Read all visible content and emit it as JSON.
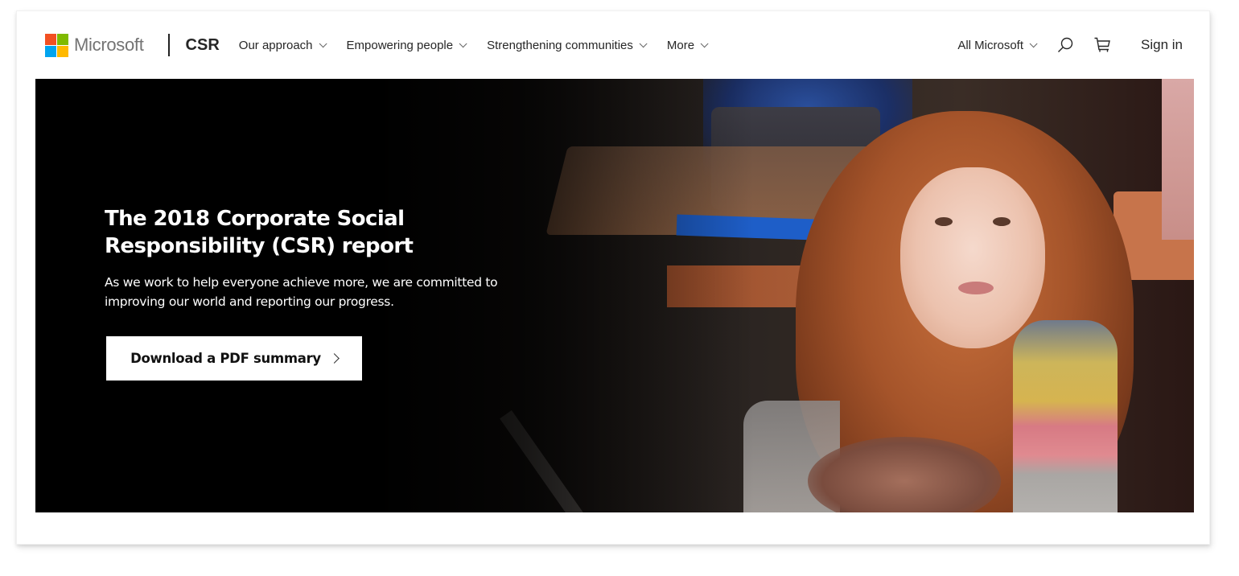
{
  "brand": {
    "company": "Microsoft",
    "section": "CSR",
    "logo_colors": [
      "#f25022",
      "#7fba00",
      "#00a4ef",
      "#ffb900"
    ]
  },
  "nav": {
    "items": [
      {
        "label": "Our approach",
        "icon": "chevron-down-icon"
      },
      {
        "label": "Empowering people",
        "icon": "chevron-down-icon"
      },
      {
        "label": "Strengthening communities",
        "icon": "chevron-down-icon"
      },
      {
        "label": "More",
        "icon": "chevron-down-icon"
      }
    ],
    "all_microsoft": "All Microsoft",
    "search_icon": "search-icon",
    "cart_icon": "cart-icon",
    "sign_in": "Sign in"
  },
  "hero": {
    "title_line1": "The 2018 Corporate Social",
    "title_line2": "Responsibility (CSR) report",
    "subtitle_line1": "As we work to help everyone achieve more, we are committed to",
    "subtitle_line2": "improving our world and reporting our progress.",
    "cta_label": "Download a PDF summary",
    "cta_icon": "chevron-right-icon",
    "image_alt": "Red-haired girl in a rainbow knit sweater smiling in a classroom"
  }
}
